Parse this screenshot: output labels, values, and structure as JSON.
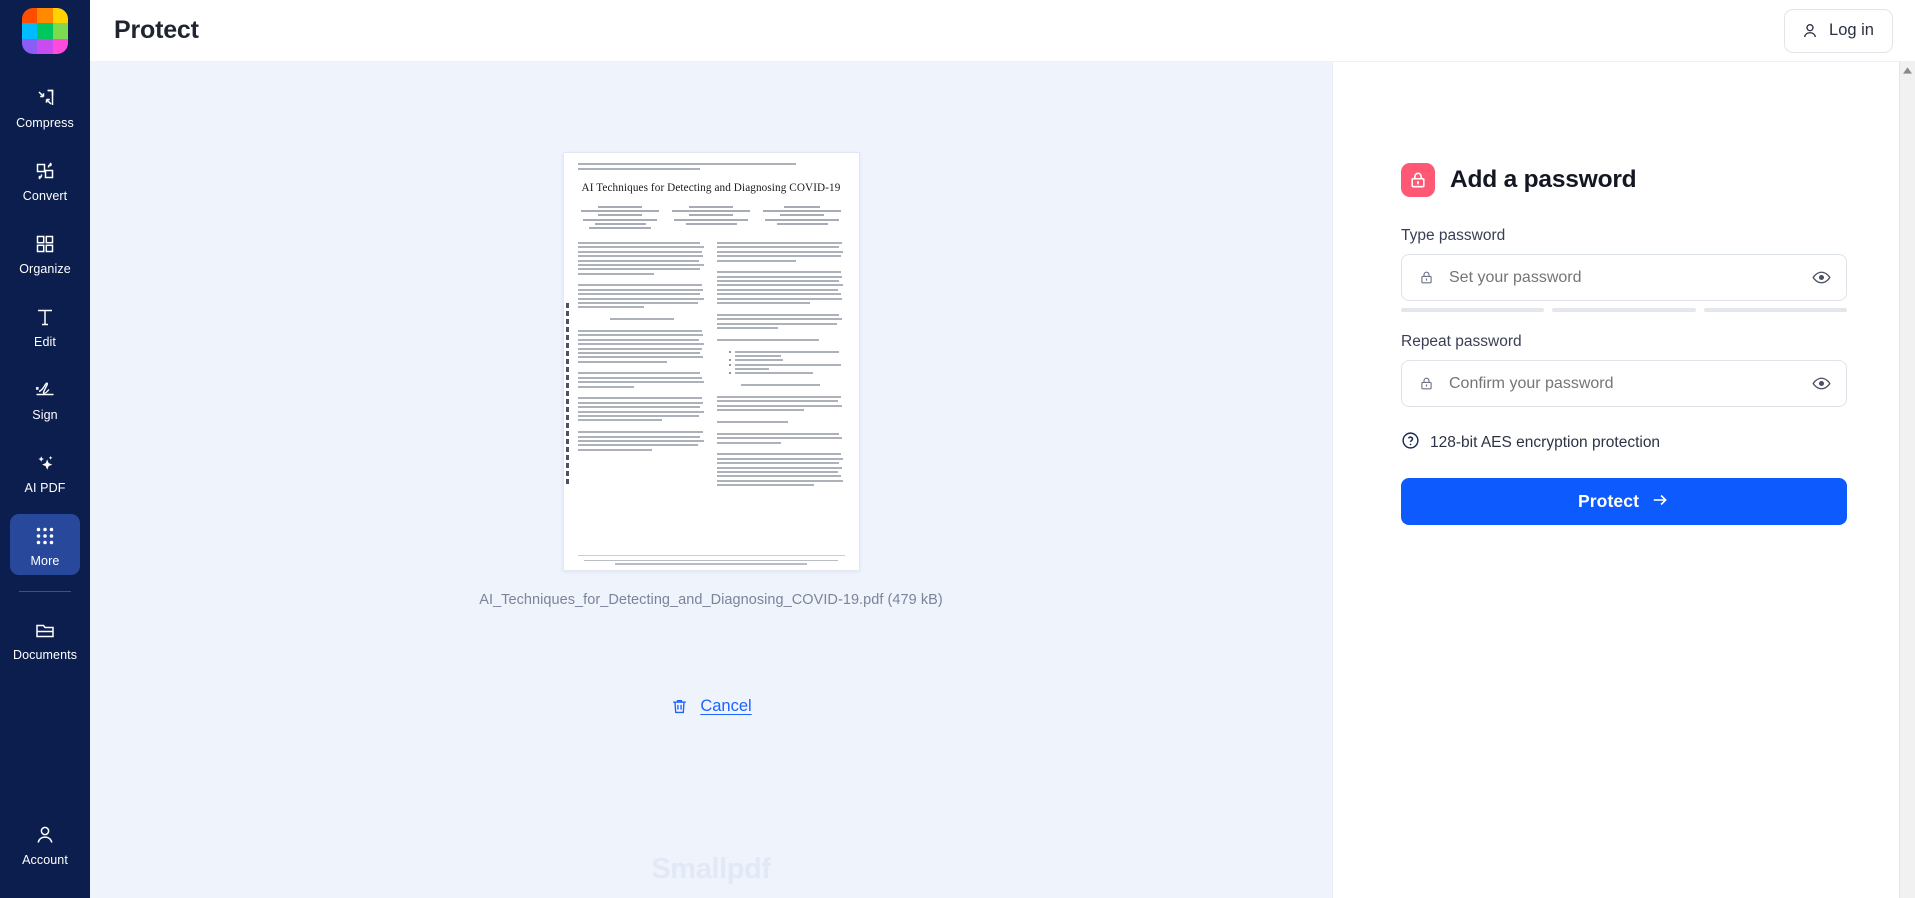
{
  "brand": {
    "logo_name": "smallpdf-logo",
    "logo_colors": [
      "#ff4d00",
      "#ff8a00",
      "#ffd200",
      "#00bcff",
      "#00c65e",
      "#7ddb4f",
      "#8b5cf6",
      "#c84cf0",
      "#ff4bdd"
    ],
    "watermark": "Smallpdf"
  },
  "sidebar": {
    "items": [
      {
        "label": "Compress",
        "icon": "compress-icon",
        "active": false
      },
      {
        "label": "Convert",
        "icon": "convert-icon",
        "active": false
      },
      {
        "label": "Organize",
        "icon": "organize-icon",
        "active": false
      },
      {
        "label": "Edit",
        "icon": "edit-icon",
        "active": false
      },
      {
        "label": "Sign",
        "icon": "sign-icon",
        "active": false
      },
      {
        "label": "AI PDF",
        "icon": "ai-pdf-icon",
        "active": false
      },
      {
        "label": "More",
        "icon": "more-grid-icon",
        "active": true
      },
      {
        "label": "Documents",
        "icon": "documents-folder-icon",
        "active": false
      }
    ],
    "account": {
      "label": "Account",
      "icon": "account-person-icon"
    },
    "active_color": "#27489b",
    "background": "#0b1e4e"
  },
  "topbar": {
    "title": "Protect",
    "login": {
      "label": "Log in",
      "icon": "person-icon"
    }
  },
  "preview": {
    "file_name_and_size": "AI_Techniques_for_Detecting_and_Diagnosing_COVID-19.pdf (479 kB)",
    "document": {
      "title": "AI Techniques for Detecting and Diagnosing COVID-19"
    },
    "cancel": {
      "label": "Cancel",
      "icon": "trash-icon"
    },
    "background": "#eff3fc"
  },
  "panel": {
    "title": "Add a password",
    "title_icon": "lock-badge-icon",
    "title_icon_color": "#ff5874",
    "fields": [
      {
        "label": "Type password",
        "placeholder": "Set your password",
        "lead_icon": "lock-icon",
        "trail_icon": "eye-icon",
        "strength_segments": 3
      },
      {
        "label": "Repeat password",
        "placeholder": "Confirm your password",
        "lead_icon": "lock-icon",
        "trail_icon": "eye-icon",
        "strength_segments": 0
      }
    ],
    "encryption_note": {
      "text": "128-bit AES encryption protection",
      "icon": "question-circle-icon"
    },
    "submit": {
      "label": "Protect",
      "icon": "arrow-right-icon",
      "color": "#0d5bff"
    }
  }
}
